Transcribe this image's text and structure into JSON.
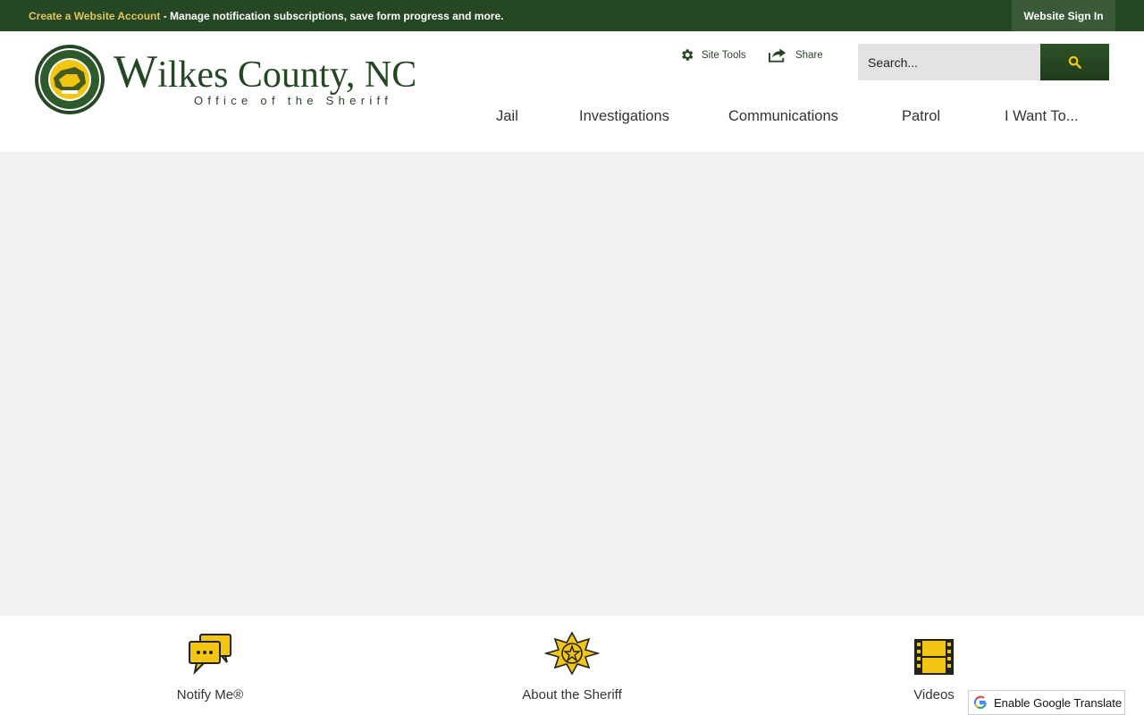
{
  "topbar": {
    "create_account_link": "Create a Website Account",
    "message": " - Manage notification subscriptions, save form progress and more.",
    "sign_in_label": "Website Sign In"
  },
  "header": {
    "logo_title_initial": "W",
    "logo_title_rest": "ilkes County, NC",
    "logo_subtitle": "Office of the Sheriff",
    "site_tools_label": "Site Tools",
    "share_label": "Share",
    "search_placeholder": "Search..."
  },
  "nav": {
    "items": [
      {
        "label": "Jail"
      },
      {
        "label": "Investigations"
      },
      {
        "label": "Communications"
      },
      {
        "label": "Patrol"
      },
      {
        "label": "I Want To..."
      }
    ]
  },
  "quick_links": [
    {
      "label": "Notify Me®",
      "icon": "chat-bubbles-icon"
    },
    {
      "label": "About the Sheriff",
      "icon": "sheriff-star-badge-icon"
    },
    {
      "label": "Videos",
      "icon": "film-strip-icon"
    }
  ],
  "translate": {
    "label": "Enable Google Translate",
    "icon": "google-translate-icon"
  },
  "colors": {
    "brand_green": "#264723",
    "accent_gold": "#e2c55a",
    "icon_yellow": "#f2c511",
    "background": "#f2f2f2"
  }
}
